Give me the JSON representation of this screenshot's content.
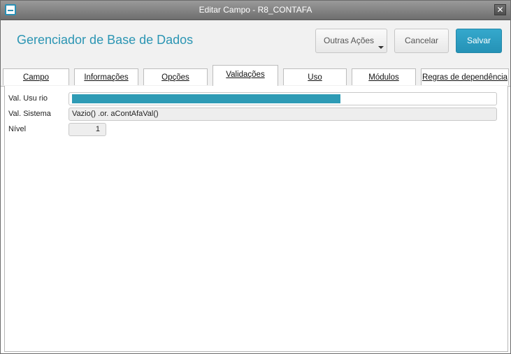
{
  "window": {
    "title": "Editar Campo - R8_CONTAFA",
    "close_glyph": "✕"
  },
  "header": {
    "app_title": "Gerenciador de Base de Dados",
    "more_actions_label": "Outras Ações",
    "cancel_label": "Cancelar",
    "save_label": "Salvar"
  },
  "tabs": [
    {
      "label": "Campo",
      "active": false
    },
    {
      "label": "Informações",
      "active": false
    },
    {
      "label": "Opções",
      "active": false
    },
    {
      "label": "Validações",
      "active": true
    },
    {
      "label": "Uso",
      "active": false
    },
    {
      "label": "Módulos",
      "active": false
    },
    {
      "label": "Regras de dependência",
      "active": false
    }
  ],
  "form": {
    "val_usuario_label": "Val. Usu rio",
    "val_usuario_value": "",
    "val_sistema_label": "Val. Sistema",
    "val_sistema_value": "Vazio() .or. aContAfaVal()",
    "nivel_label": "Nível",
    "nivel_value": "1"
  },
  "colors": {
    "accent": "#2b95b3",
    "save_button": "#2592b6",
    "selection": "#2e9bb5"
  }
}
